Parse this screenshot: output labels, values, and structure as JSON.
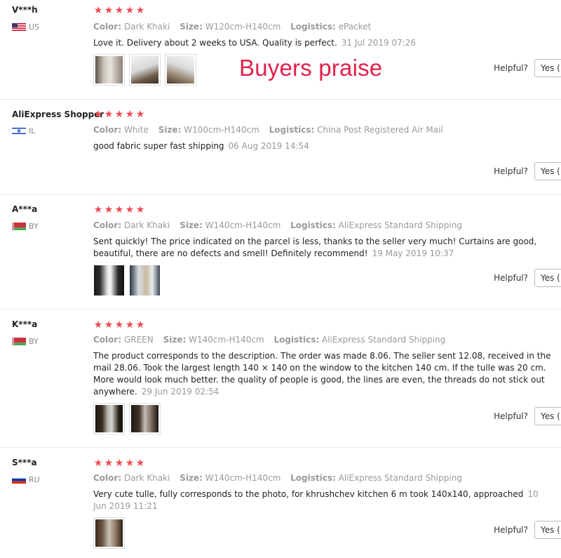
{
  "banner": "Buyers praise",
  "labels": {
    "color": "Color:",
    "size": "Size:",
    "logistics": "Logistics:",
    "helpful": "Helpful?",
    "yes": "Yes ("
  },
  "colors": {
    "star": "#f04950",
    "banner": "#e4204a"
  },
  "reviews": [
    {
      "user": "V***h",
      "country": "US",
      "flag": "us-flag-icon",
      "stars": 5,
      "color": "Dark Khaki",
      "size": "W120cm-H140cm",
      "logistics": "ePacket",
      "text": "Love it. Delivery about 2 weeks to USA. Quality is perfect.",
      "date": "31 Jul 2019 07:26",
      "photos": 3
    },
    {
      "user": "AliExpress Shopper",
      "country": "IL",
      "flag": "il-flag-icon",
      "stars": 5,
      "color": "White",
      "size": "W100cm-H140cm",
      "logistics": "China Post Registered Air Mail",
      "text": "good fabric super fast shipping",
      "date": "06 Aug 2019 14:54",
      "photos": 0
    },
    {
      "user": "A***a",
      "country": "BY",
      "flag": "by-flag-icon",
      "stars": 5,
      "color": "Dark Khaki",
      "size": "W140cm-H140cm",
      "logistics": "AliExpress Standard Shipping",
      "text": "Sent quickly! The price indicated on the parcel is less, thanks to the seller very much! Curtains are good, beautiful, there are no defects and smell! Definitely recommend!",
      "date": "19 May 2019 10:37",
      "photos": 2
    },
    {
      "user": "K***a",
      "country": "BY",
      "flag": "by-flag-icon",
      "stars": 5,
      "color": "GREEN",
      "size": "W140cm-H140cm",
      "logistics": "AliExpress Standard Shipping",
      "text": "The product corresponds to the description. The order was made 8.06. The seller sent 12.08, received in the mail 28.06. Took the largest length 140 × 140 on the window to the kitchen 140 cm. If the tulle was 20 cm. More would look much better. the quality of people is good, the lines are even, the threads do not stick out anywhere.",
      "date": "29 Jun 2019 02:54",
      "photos": 2
    },
    {
      "user": "S***a",
      "country": "RU",
      "flag": "ru-flag-icon",
      "stars": 5,
      "color": "Dark Khaki",
      "size": "W140cm-H140cm",
      "logistics": "AliExpress Standard Shipping",
      "text": "Very cute tulle, fully corresponds to the photo, for khrushchev kitchen 6 m took 140x140, approached",
      "date": "10 Jun 2019 11:21",
      "photos": 1
    }
  ]
}
